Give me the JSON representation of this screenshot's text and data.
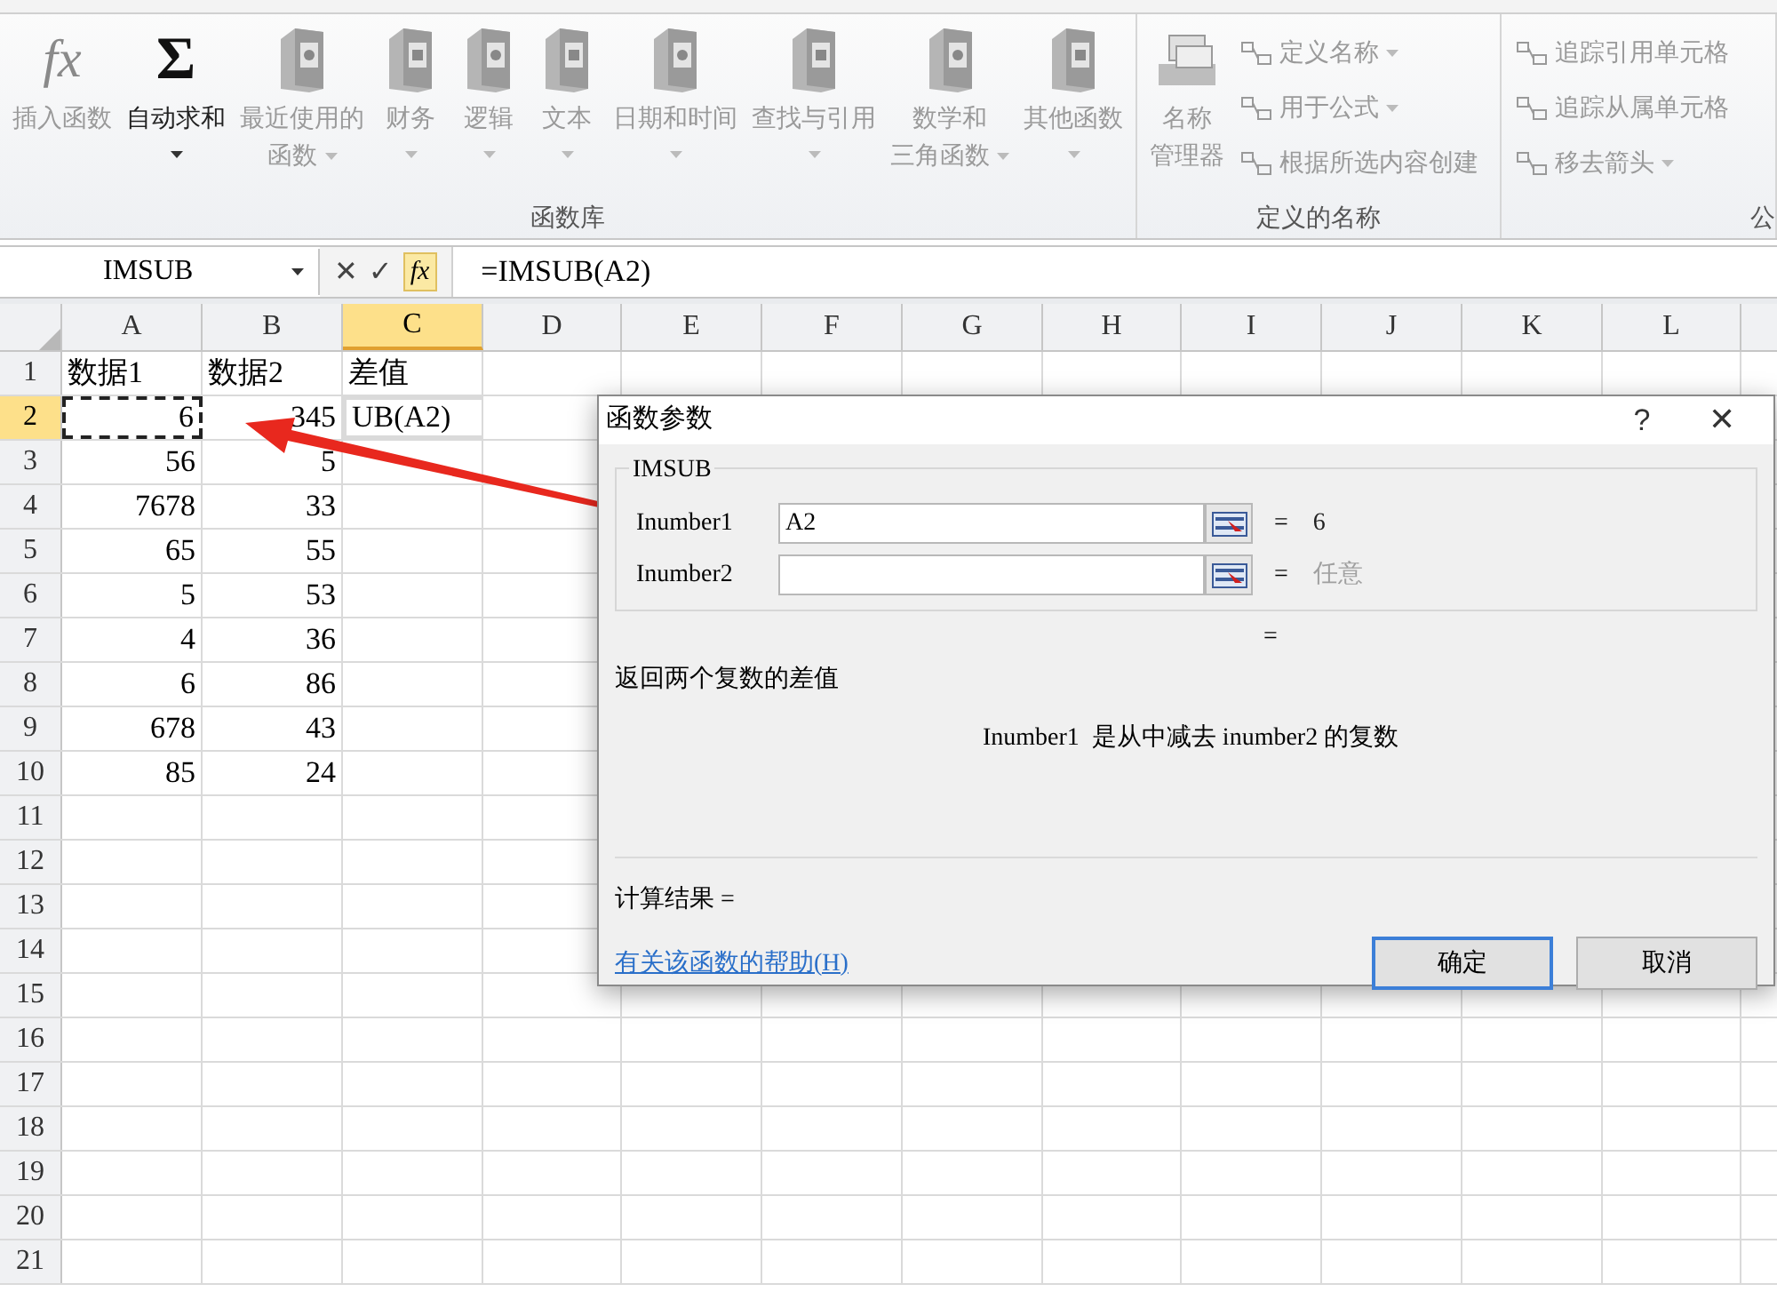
{
  "ribbon": {
    "groups": [
      {
        "label": "函数库",
        "buttons": [
          {
            "kind": "big",
            "glyph": "fx",
            "lines": [
              "插入函数"
            ],
            "disabled": true,
            "dropdown": false
          },
          {
            "kind": "big",
            "glyph": "Σ",
            "lines": [
              "自动求和"
            ],
            "disabled": false,
            "dropdown": true
          },
          {
            "kind": "big",
            "lines": [
              "最近使用的",
              "函数"
            ],
            "disabled": true,
            "dropdown": true
          },
          {
            "kind": "big",
            "lines": [
              "财务"
            ],
            "disabled": true,
            "dropdown": true
          },
          {
            "kind": "big",
            "lines": [
              "逻辑"
            ],
            "disabled": true,
            "dropdown": true
          },
          {
            "kind": "big",
            "lines": [
              "文本"
            ],
            "disabled": true,
            "dropdown": true
          },
          {
            "kind": "big",
            "lines": [
              "日期和时间"
            ],
            "disabled": true,
            "dropdown": true
          },
          {
            "kind": "big",
            "lines": [
              "查找与引用"
            ],
            "disabled": true,
            "dropdown": true
          },
          {
            "kind": "big",
            "lines": [
              "数学和",
              "三角函数"
            ],
            "disabled": true,
            "dropdown": true
          },
          {
            "kind": "big",
            "lines": [
              "其他函数"
            ],
            "disabled": true,
            "dropdown": true
          }
        ]
      },
      {
        "label": "定义的名称",
        "buttons": [
          {
            "kind": "big",
            "lines": [
              "名称",
              "管理器"
            ],
            "disabled": true,
            "dropdown": false
          },
          {
            "kind": "small",
            "lines": [
              "定义名称"
            ],
            "disabled": true,
            "dropdown": true
          },
          {
            "kind": "small",
            "lines": [
              "用于公式"
            ],
            "disabled": true,
            "dropdown": true
          },
          {
            "kind": "small",
            "lines": [
              "根据所选内容创建"
            ],
            "disabled": true,
            "dropdown": false
          }
        ]
      },
      {
        "label": "公",
        "buttons": [
          {
            "kind": "small",
            "lines": [
              "追踪引用单元格"
            ],
            "disabled": true,
            "dropdown": false
          },
          {
            "kind": "small",
            "lines": [
              "追踪从属单元格"
            ],
            "disabled": true,
            "dropdown": false
          },
          {
            "kind": "small",
            "lines": [
              "移去箭头"
            ],
            "disabled": true,
            "dropdown": true
          }
        ]
      }
    ]
  },
  "formula_bar": {
    "name_box": "IMSUB",
    "cancel": "✕",
    "enter": "✓",
    "insert_function": "fx",
    "formula": "=IMSUB(A2)"
  },
  "sheet": {
    "columns": [
      {
        "label": "A",
        "selected": false
      },
      {
        "label": "B",
        "selected": false
      },
      {
        "label": "C",
        "selected": true
      },
      {
        "label": "D",
        "selected": false
      },
      {
        "label": "E",
        "selected": false
      },
      {
        "label": "F",
        "selected": false
      },
      {
        "label": "G",
        "selected": false
      },
      {
        "label": "H",
        "selected": false
      },
      {
        "label": "I",
        "selected": false
      },
      {
        "label": "J",
        "selected": false
      },
      {
        "label": "K",
        "selected": false
      },
      {
        "label": "L",
        "selected": false
      }
    ],
    "rows": [
      {
        "header": "1",
        "selected": false,
        "cells": [
          {
            "text": "数据1",
            "kind": "text"
          },
          {
            "text": "数据2",
            "kind": "text"
          },
          {
            "text": "差值",
            "kind": "text"
          }
        ]
      },
      {
        "header": "2",
        "selected": true,
        "cells": [
          {
            "text": "6",
            "kind": "number",
            "marquee": true
          },
          {
            "text": "345",
            "kind": "number"
          },
          {
            "text": "UB(A2)",
            "kind": "text",
            "active": true
          }
        ]
      },
      {
        "header": "3",
        "selected": false,
        "cells": [
          {
            "text": "56",
            "kind": "number"
          },
          {
            "text": "5",
            "kind": "number"
          }
        ]
      },
      {
        "header": "4",
        "selected": false,
        "cells": [
          {
            "text": "7678",
            "kind": "number"
          },
          {
            "text": "33",
            "kind": "number"
          }
        ]
      },
      {
        "header": "5",
        "selected": false,
        "cells": [
          {
            "text": "65",
            "kind": "number"
          },
          {
            "text": "55",
            "kind": "number"
          }
        ]
      },
      {
        "header": "6",
        "selected": false,
        "cells": [
          {
            "text": "5",
            "kind": "number"
          },
          {
            "text": "53",
            "kind": "number"
          }
        ]
      },
      {
        "header": "7",
        "selected": false,
        "cells": [
          {
            "text": "4",
            "kind": "number"
          },
          {
            "text": "36",
            "kind": "number"
          }
        ]
      },
      {
        "header": "8",
        "selected": false,
        "cells": [
          {
            "text": "6",
            "kind": "number"
          },
          {
            "text": "86",
            "kind": "number"
          }
        ]
      },
      {
        "header": "9",
        "selected": false,
        "cells": [
          {
            "text": "678",
            "kind": "number"
          },
          {
            "text": "43",
            "kind": "number"
          }
        ]
      },
      {
        "header": "10",
        "selected": false,
        "cells": [
          {
            "text": "85",
            "kind": "number"
          },
          {
            "text": "24",
            "kind": "number"
          }
        ]
      },
      {
        "header": "11",
        "selected": false,
        "cells": []
      },
      {
        "header": "12",
        "selected": false,
        "cells": []
      },
      {
        "header": "13",
        "selected": false,
        "cells": []
      },
      {
        "header": "14",
        "selected": false,
        "cells": []
      },
      {
        "header": "15",
        "selected": false,
        "cells": []
      },
      {
        "header": "16",
        "selected": false,
        "cells": []
      },
      {
        "header": "17",
        "selected": false,
        "cells": []
      },
      {
        "header": "18",
        "selected": false,
        "cells": []
      },
      {
        "header": "19",
        "selected": false,
        "cells": []
      },
      {
        "header": "20",
        "selected": false,
        "cells": []
      },
      {
        "header": "21",
        "selected": false,
        "cells": []
      }
    ]
  },
  "dialog": {
    "title": "函数参数",
    "help": "?",
    "close": "✕",
    "function_name": "IMSUB",
    "arguments": [
      {
        "label": "Inumber1",
        "value": "A2",
        "equals": "=",
        "result": "6",
        "muted": false
      },
      {
        "label": "Inumber2",
        "equals": "=",
        "result": "任意",
        "muted": true
      }
    ],
    "overall_equals": "=",
    "description": "返回两个复数的差值",
    "argument_help": "Inumber1  是从中减去 inumber2 的复数",
    "result_label": "计算结果 =",
    "help_link": "有关该函数的帮助(H)",
    "buttons": [
      {
        "label": "确定",
        "default": true
      },
      {
        "label": "取消",
        "default": false
      }
    ]
  }
}
